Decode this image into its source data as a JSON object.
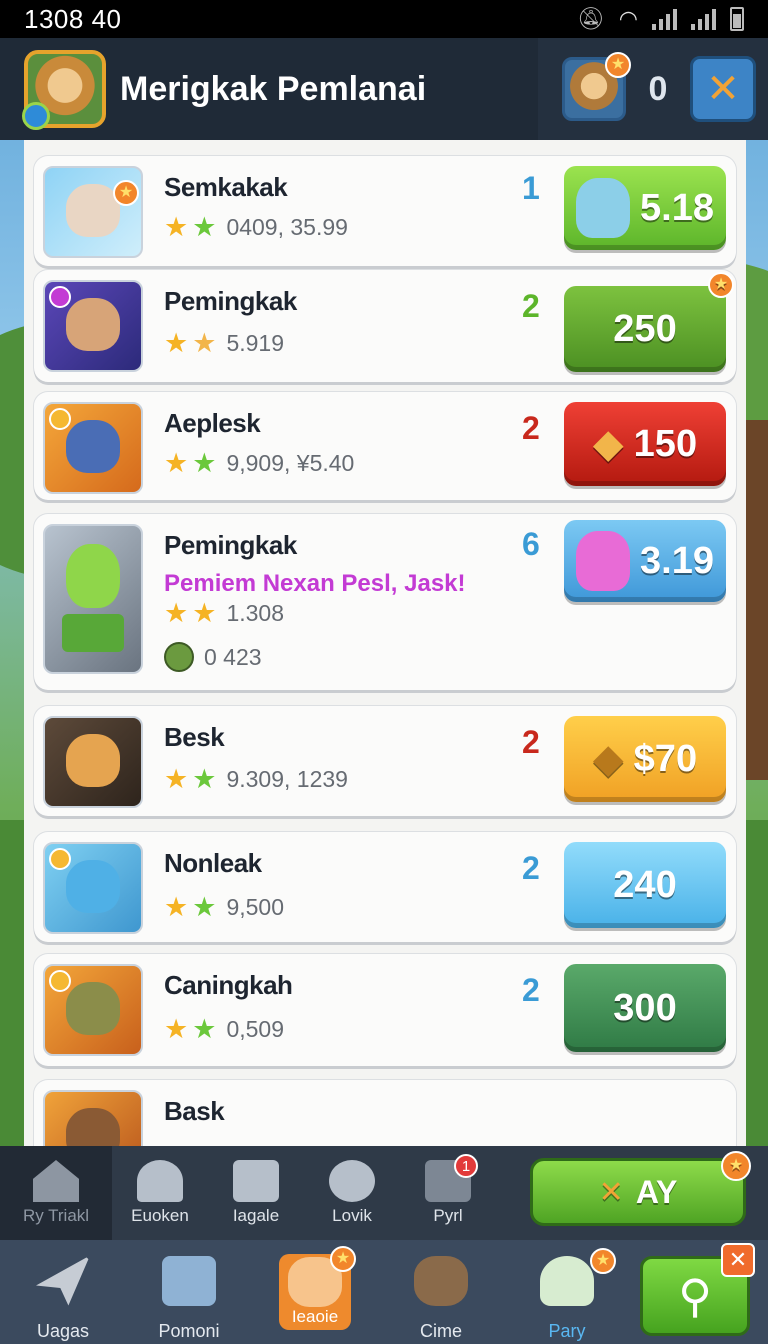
{
  "status_bar": {
    "time": "1308 40"
  },
  "header": {
    "title": "Merigkak Pemlanai",
    "count": "0"
  },
  "cards": [
    {
      "name": "Semkakak",
      "stat": "0409, 35.99",
      "rank": "1",
      "rank_color": "#3a9bd5",
      "price": "5.18",
      "subtitle": ""
    },
    {
      "name": "Pemingkak",
      "stat": "5.919",
      "rank": "2",
      "rank_color": "#5cb52a",
      "price": "250",
      "subtitle": ""
    },
    {
      "name": "Aeplesk",
      "stat": "9,909, ¥5.40",
      "rank": "2",
      "rank_color": "#c8281c",
      "price": "150",
      "subtitle": ""
    },
    {
      "name": "Pemingkak",
      "stat": "1.308",
      "stat2": "0  423",
      "rank": "6",
      "rank_color": "#3a9bd5",
      "price": "3.19",
      "subtitle": "Pemiem Nexan Pesl, Jask!"
    },
    {
      "name": "Besk",
      "stat": "9.309, 1239",
      "rank": "2",
      "rank_color": "#c8281c",
      "price": "$70",
      "subtitle": ""
    },
    {
      "name": "Nonleak",
      "stat": "9,500",
      "rank": "2",
      "rank_color": "#3a9bd5",
      "price": "240",
      "subtitle": ""
    },
    {
      "name": "Caningkah",
      "stat": "0,509",
      "rank": "2",
      "rank_color": "#3a9bd5",
      "price": "300",
      "subtitle": ""
    },
    {
      "name": "Bask"
    }
  ],
  "nav_top": {
    "items": [
      "Ry Triakl",
      "Euoken",
      "Iagale",
      "Lovik",
      "Pyrl"
    ],
    "notif": "1",
    "action_label": "AY"
  },
  "nav_bottom": {
    "items": [
      "Uagas",
      "Pomoni",
      "Ieaoie",
      "Cime",
      "Pary"
    ]
  },
  "icons": {
    "tools": "crossed-tools-icon",
    "search": "magnifier-icon",
    "close": "close-icon"
  }
}
